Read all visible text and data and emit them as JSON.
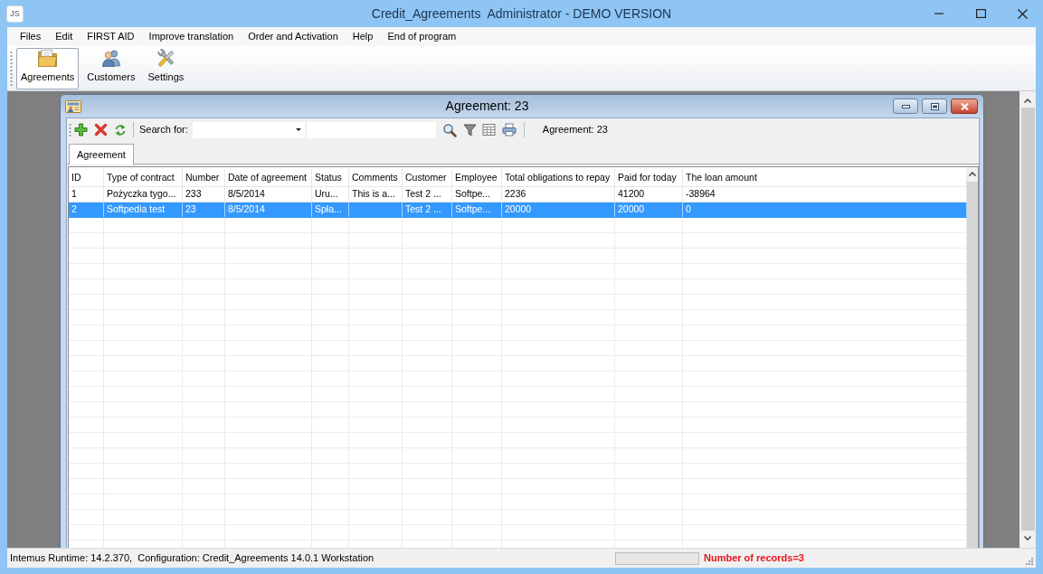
{
  "window": {
    "logo_text": "JS",
    "title": "Credit_Agreements  Administrator - DEMO VERSION"
  },
  "menu": [
    "Files",
    "Edit",
    "FIRST AID",
    "Improve translation",
    "Order and Activation",
    "Help",
    "End of program"
  ],
  "toolbar": [
    {
      "label": "Agreements",
      "selected": true
    },
    {
      "label": "Customers",
      "selected": false
    },
    {
      "label": "Settings",
      "selected": false
    }
  ],
  "child_window": {
    "title": "Agreement: 23",
    "search_label": "Search for:",
    "record_label": "Agreement: 23",
    "tabs": [
      {
        "label": "Agreement",
        "selected": true
      }
    ],
    "table": {
      "columns": [
        "ID",
        "Type of contract",
        "Number",
        "Date of agreement",
        "Status",
        "Comments",
        "Customer",
        "Employee",
        "Total obligations to repay",
        "Paid for today",
        "The loan amount"
      ],
      "rows": [
        {
          "selected": false,
          "cells": [
            "1",
            "Pożyczka tygo...",
            "233",
            "8/5/2014",
            "Uru...",
            "This is a...",
            "Test 2 ...",
            "Softpe...",
            "2236",
            "41200",
            "-38964"
          ]
        },
        {
          "selected": true,
          "cells": [
            "2",
            "Softpedia test",
            "23",
            "8/5/2014",
            "Spła...",
            null,
            "Test 2 ...",
            "Softpe...",
            "20000",
            "20000",
            "0"
          ]
        }
      ]
    }
  },
  "status_bar": {
    "text": "Intemus Runtime: 14.2.370,  Configuration: Credit_Agreements 14.0.1 Workstation",
    "progress": {
      "level": 0
    },
    "records": "Number of records=3"
  }
}
